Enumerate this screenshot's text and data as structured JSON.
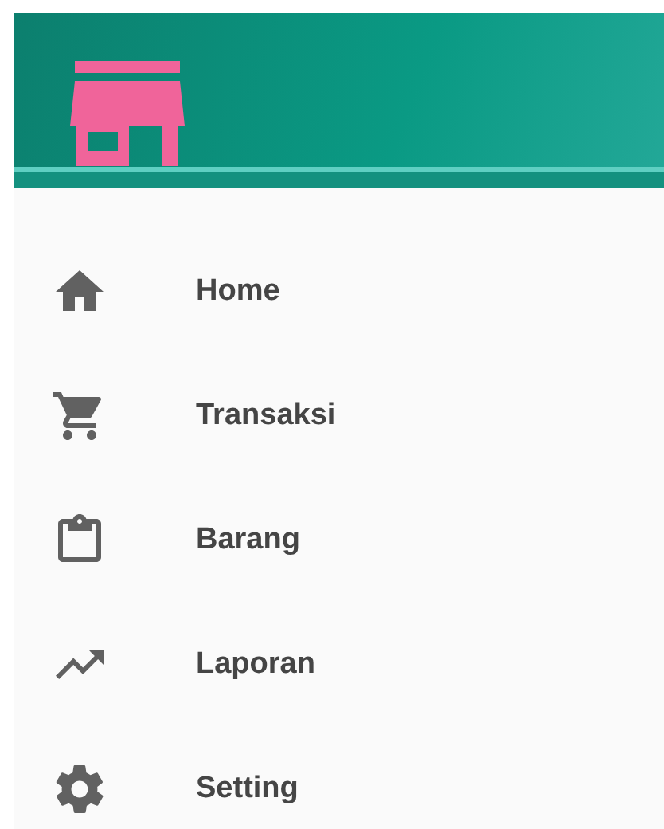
{
  "drawer": {
    "items": [
      {
        "label": "Home"
      },
      {
        "label": "Transaksi"
      },
      {
        "label": "Barang"
      },
      {
        "label": "Laporan"
      },
      {
        "label": "Setting"
      }
    ]
  }
}
